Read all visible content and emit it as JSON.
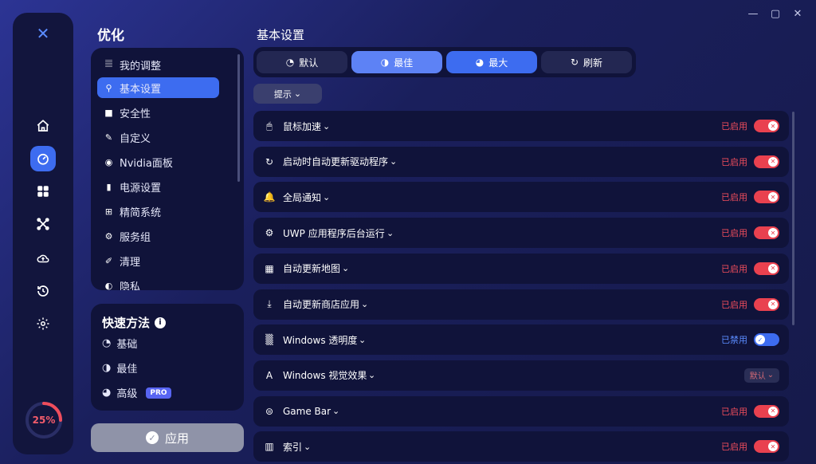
{
  "window": {
    "minimize": "—",
    "maximize": "▢",
    "close": "✕"
  },
  "rail": {
    "logo": "✕",
    "gauge_value": 0.25,
    "gauge_label": "25%"
  },
  "sidebar": {
    "title": "优化",
    "items": [
      {
        "label": "我的调整",
        "icon": "tweaks-icon"
      },
      {
        "label": "基本设置",
        "icon": "basic-settings-icon"
      },
      {
        "label": "安全性",
        "icon": "lock-icon"
      },
      {
        "label": "自定义",
        "icon": "brush-icon"
      },
      {
        "label": "Nvidia面板",
        "icon": "nvidia-icon"
      },
      {
        "label": "电源设置",
        "icon": "battery-icon"
      },
      {
        "label": "精简系统",
        "icon": "windows-icon"
      },
      {
        "label": "服务组",
        "icon": "services-icon"
      },
      {
        "label": "清理",
        "icon": "broom-icon"
      },
      {
        "label": "隐私",
        "icon": "privacy-icon"
      }
    ]
  },
  "quick": {
    "title": "快速方法",
    "items": [
      {
        "label": "基础"
      },
      {
        "label": "最佳"
      },
      {
        "label": "高级",
        "badge": "PRO"
      }
    ]
  },
  "apply": {
    "label": "应用"
  },
  "main": {
    "title": "基本设置",
    "presets": [
      {
        "label": "默认"
      },
      {
        "label": "最佳"
      },
      {
        "label": "最大"
      },
      {
        "label": "刷新"
      }
    ],
    "hint": "提示",
    "rows": [
      {
        "label": "鼠标加速",
        "status": "已启用",
        "state": "on",
        "icon": "mouse-icon"
      },
      {
        "label": "启动时自动更新驱动程序",
        "status": "已启用",
        "state": "on",
        "icon": "refresh-icon"
      },
      {
        "label": "全局通知",
        "status": "已启用",
        "state": "on",
        "icon": "bell-icon"
      },
      {
        "label": "UWP 应用程序后台运行",
        "status": "已启用",
        "state": "on",
        "icon": "gears-icon"
      },
      {
        "label": "自动更新地图",
        "status": "已启用",
        "state": "on",
        "icon": "map-icon"
      },
      {
        "label": "自动更新商店应用",
        "status": "已启用",
        "state": "on",
        "icon": "download-icon"
      },
      {
        "label": "Windows 透明度",
        "status": "已禁用",
        "state": "off",
        "icon": "transparency-icon"
      },
      {
        "label": "Windows 视觉效果",
        "status": "默认",
        "state": "dropdown",
        "icon": "visual-effects-icon"
      },
      {
        "label": "Game Bar",
        "status": "已启用",
        "state": "on",
        "icon": "gamepad-icon"
      },
      {
        "label": "索引",
        "status": "已启用",
        "state": "on",
        "icon": "index-icon"
      }
    ]
  },
  "colors": {
    "accent": "#3d6cf0",
    "enabled": "#ef4d5c",
    "disabled": "#5b8cff",
    "panel": "#10133a"
  }
}
